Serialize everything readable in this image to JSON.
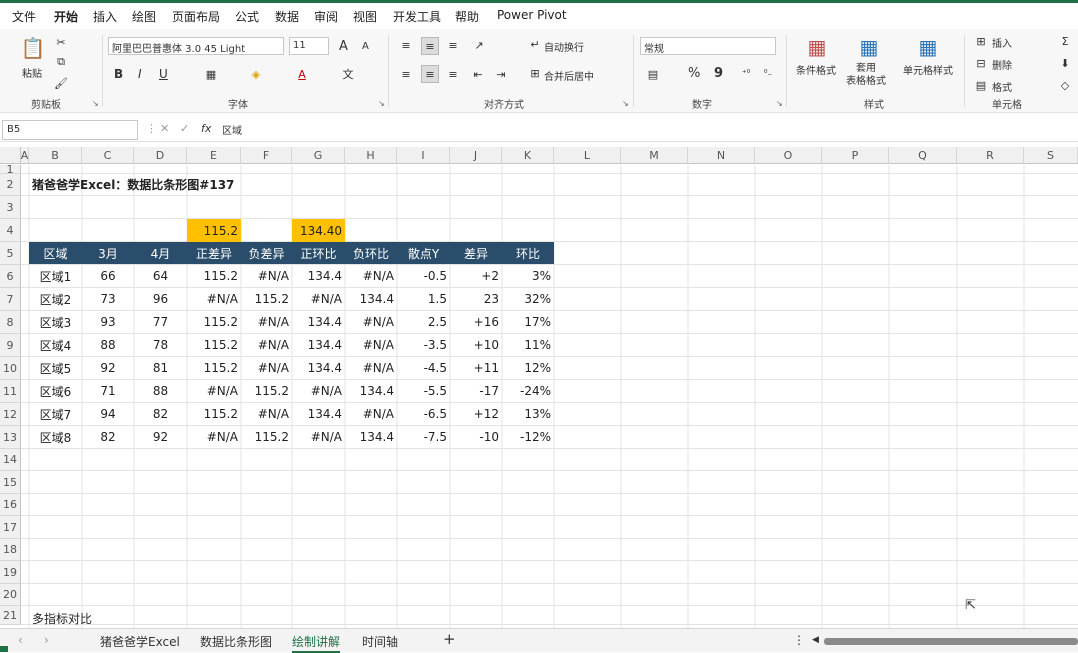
{
  "menu": [
    "文件",
    "开始",
    "插入",
    "绘图",
    "页面布局",
    "公式",
    "数据",
    "审阅",
    "视图",
    "开发工具",
    "帮助",
    "Power Pivot"
  ],
  "ribbon": {
    "paste": "粘贴",
    "font_name": "阿里巴巴普惠体 3.0 45 Light",
    "font_size": "11",
    "grow": "A",
    "shrink": "A",
    "bold": "B",
    "italic": "I",
    "underline": "U",
    "wrap": "自动换行",
    "merge": "合并后居中",
    "number_format": "常规",
    "percent": "%",
    "comma": "9",
    "cond_format": "条件格式",
    "table_format": "套用\n表格格式",
    "cell_styles": "单元格样式",
    "insert": "插入",
    "delete": "删除",
    "format": "格式",
    "groups": {
      "clipboard": "剪贴板",
      "font": "字体",
      "align": "对齐方式",
      "number": "数字",
      "styles": "样式",
      "cells": "单元格"
    }
  },
  "formula": {
    "name_box": "B5",
    "fx": "fx",
    "content": "区域"
  },
  "columns": [
    "A",
    "B",
    "C",
    "D",
    "E",
    "F",
    "G",
    "H",
    "I",
    "J",
    "K",
    "L",
    "M",
    "N",
    "O",
    "P",
    "Q",
    "R",
    "S"
  ],
  "rows": [
    "1",
    "2",
    "3",
    "4",
    "5",
    "6",
    "7",
    "8",
    "9",
    "10",
    "11",
    "12",
    "13",
    "14",
    "15",
    "16",
    "17",
    "18",
    "19",
    "20",
    "21"
  ],
  "title": "猪爸爸学Excel：数据比条形图#137",
  "e4": "115.2",
  "g4": "134.40",
  "table": {
    "headers": [
      "区域",
      "3月",
      "4月",
      "正差异",
      "负差异",
      "正环比",
      "负环比",
      "散点Y",
      "差异",
      "环比"
    ],
    "rows": [
      [
        "区域1",
        "66",
        "64",
        "115.2",
        "#N/A",
        "134.4",
        "#N/A",
        "-0.5",
        "+2",
        "3%"
      ],
      [
        "区域2",
        "73",
        "96",
        "#N/A",
        "115.2",
        "#N/A",
        "134.4",
        "1.5",
        "23",
        "32%"
      ],
      [
        "区域3",
        "93",
        "77",
        "115.2",
        "#N/A",
        "134.4",
        "#N/A",
        "2.5",
        "+16",
        "17%"
      ],
      [
        "区域4",
        "88",
        "78",
        "115.2",
        "#N/A",
        "134.4",
        "#N/A",
        "-3.5",
        "+10",
        "11%"
      ],
      [
        "区域5",
        "92",
        "81",
        "115.2",
        "#N/A",
        "134.4",
        "#N/A",
        "-4.5",
        "+11",
        "12%"
      ],
      [
        "区域6",
        "71",
        "88",
        "#N/A",
        "115.2",
        "#N/A",
        "134.4",
        "-5.5",
        "-17",
        "-24%"
      ],
      [
        "区域7",
        "94",
        "82",
        "115.2",
        "#N/A",
        "134.4",
        "#N/A",
        "-6.5",
        "+12",
        "13%"
      ],
      [
        "区域8",
        "82",
        "92",
        "#N/A",
        "115.2",
        "#N/A",
        "134.4",
        "-7.5",
        "-10",
        "-12%"
      ]
    ]
  },
  "b21": "多指标对比",
  "sheets": [
    "猪爸爸学Excel",
    "数据比条形图",
    "绘制讲解",
    "时间轴"
  ],
  "add_sheet": "+"
}
